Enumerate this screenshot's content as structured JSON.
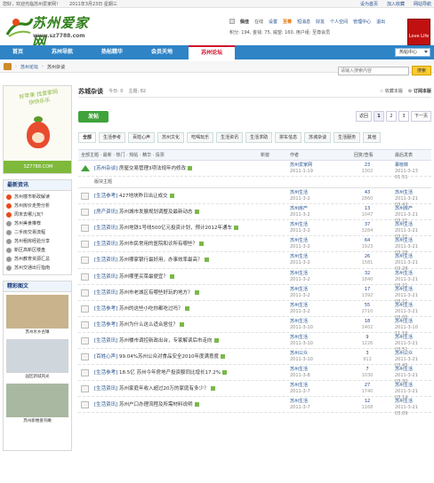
{
  "topbar": {
    "left": [
      "您好，欢迎光临苏州爱家网！",
      "2011年3月23日 星期三"
    ],
    "right": [
      "设为首页",
      "加入收藏",
      "网站导航"
    ]
  },
  "brand": {
    "name": "苏州爱家网",
    "url": "www.sz7788.com"
  },
  "user": {
    "name": "佩佳",
    "status": "在线",
    "settings": "设置",
    "vip": "至尊",
    "messages": "短消息",
    "friends": "好友",
    "spaces": "个人空间",
    "mgmt": "管理中心",
    "logout": "退出",
    "credits": "积分: 194, 金钱: 75, 威望: 160, 用户组: 至尊会员"
  },
  "promo": "Love Life",
  "nav": {
    "tabs": [
      "首页",
      "苏州导航",
      "热帖精华",
      "会员天地",
      "苏州论坛"
    ],
    "current": 4,
    "search": "热帖中心"
  },
  "breadcrumb": [
    "苏州论坛",
    "苏州杂谈"
  ],
  "sidebar": {
    "ad": {
      "text": "好苹果 找爱家网 快快乐乐",
      "site": "SZ7788.COM"
    },
    "hot_title": "最新资讯",
    "hot_items": [
      "苏州楼市新政解读",
      "苏州房价走势分析",
      "周末去哪儿玩？",
      "苏州美食推荐",
      "二手房交易流程",
      "苏州租房经验分享",
      "新区高新区楼盘",
      "苏州教育资源汇总",
      "苏州交通出行指南"
    ],
    "photo_title": "精彩图文",
    "photos": [
      "苏州水乡古镇",
      "园区新城风光",
      "苏州新楼盘鸟瞰"
    ]
  },
  "forum": {
    "title": "苏城杂谈",
    "today": "今日: 0",
    "topics": "主题: 82",
    "search_placeholder": "请输入搜索内容",
    "search_btn": "搜索",
    "rss": "收藏本版",
    "follow": "订阅本版",
    "post_btn": "发帖",
    "pager": [
      "返回",
      "1",
      "2",
      "3",
      "下一页"
    ]
  },
  "filters": [
    "全部",
    "生活参考",
    "百姓心声",
    "苏州文化",
    "吃喝玩乐",
    "生活资讯",
    "生活求助",
    "拼车信息",
    "苏城杂谈",
    "生活服务",
    "其他"
  ],
  "table_head": {
    "subject": "作者",
    "filters": "全部主题 · 最新 · 热门 · 热帖 · 精华 · 投票",
    "new": "新窗",
    "author": "作者",
    "replies": "回复/查看",
    "last": "最后发表"
  },
  "rows": [
    {
      "cat": "[苏州杂谈]",
      "title": "房屋交易管理3项法规年内修改",
      "hot": false,
      "top": true,
      "author": "苏州爱家网",
      "date": "2011-1-19",
      "r": "23",
      "v": "1302",
      "last_user": "慕晓菲",
      "last_date": "2011-3-23 01:51"
    },
    {
      "cat": "[生活参考]",
      "title": "427地块昨日出让成交",
      "hot": false,
      "top": false,
      "author": "苏州生活",
      "date": "2011-3-2",
      "r": "43",
      "v": "2860",
      "last_user": "苏州生活",
      "last_date": "2011-3-21 03:43"
    },
    {
      "cat": "[房产资讯]",
      "title": "苏州城市发展规划调整及最新动态",
      "hot": false,
      "top": false,
      "author": "苏州房产",
      "date": "2011-3-2",
      "r": "13",
      "v": "1047",
      "last_user": "苏州房产",
      "last_date": "2011-3-21 03:21"
    },
    {
      "cat": "[生活资讯]",
      "title": "苏州地铁1号线500亿元投资计划，预计2012年通车",
      "hot": false,
      "top": false,
      "author": "苏州生活",
      "date": "2011-3-2",
      "r": "37",
      "v": "3284",
      "last_user": "苏州生活",
      "last_date": "2011-3-21 03:21"
    },
    {
      "cat": "[生活资讯]",
      "title": "苏州市民常用的医院和诊所有哪些？",
      "hot": false,
      "top": false,
      "author": "苏州生活",
      "date": "2011-3-2",
      "r": "64",
      "v": "1923",
      "last_user": "苏州生活",
      "last_date": "2011-3-21 03:28"
    },
    {
      "cat": "[生活资讯]",
      "title": "苏州哪家银行最好用，办事效率最高？",
      "hot": false,
      "top": false,
      "author": "苏州生活",
      "date": "2011-3-2",
      "r": "26",
      "v": "1581",
      "last_user": "苏州生活",
      "last_date": "2011-3-21 03:28"
    },
    {
      "cat": "[生活资讯]",
      "title": "苏州哪里买菜最便宜？",
      "hot": false,
      "top": false,
      "author": "苏州生活",
      "date": "2011-3-2",
      "r": "32",
      "v": "1840",
      "last_user": "苏州生活",
      "last_date": "2011-3-21 03:21"
    },
    {
      "cat": "[生活资讯]",
      "title": "苏州市老城区有哪些好玩的地方？",
      "hot": false,
      "top": false,
      "author": "苏州生活",
      "date": "2011-3-2",
      "r": "17",
      "v": "1392",
      "last_user": "苏州生活",
      "last_date": "2011-3-21 03:21"
    },
    {
      "cat": "[生活参考]",
      "title": "苏州的这些小吃你都吃过吗？",
      "hot": false,
      "top": false,
      "author": "苏州生活",
      "date": "2011-3-2",
      "r": "55",
      "v": "2710",
      "last_user": "苏州生活",
      "last_date": "2011-3-21 03:05"
    },
    {
      "cat": "[生活参考]",
      "title": "苏州为什么这么适合居住？",
      "hot": false,
      "top": false,
      "author": "苏州生活",
      "date": "2011-3-10",
      "r": "18",
      "v": "1402",
      "last_user": "苏州生活",
      "last_date": "2011-3-10 11:16"
    },
    {
      "cat": "[生活资讯]",
      "title": "苏州楼市调控新政出台，专家解读后市走向",
      "hot": false,
      "top": false,
      "author": "苏州生活",
      "date": "2011-3-10",
      "r": "9",
      "v": "1226",
      "last_user": "苏州生活",
      "last_date": "2011-3-21 03:51"
    },
    {
      "cat": "[百姓心声]",
      "title": "99.04%苏州公众对食品安全2010年度满意度",
      "hot": false,
      "top": false,
      "author": "苏州公众",
      "date": "2011-3-10",
      "r": "3",
      "v": "912",
      "last_user": "苏州公众",
      "last_date": "2011-3-21 03:45"
    },
    {
      "cat": "[生活参考]",
      "title": "18.5亿 苏州今年房地产投资额同比增长17.2%",
      "hot": false,
      "top": false,
      "author": "苏州生活",
      "date": "2011-3-8",
      "r": "7",
      "v": "1030",
      "last_user": "苏州生活",
      "last_date": "2011-3-21 03:30"
    },
    {
      "cat": "[生活资讯]",
      "title": "苏州家庭年收入超过20万的家庭有多少？",
      "hot": false,
      "top": false,
      "author": "苏州生活",
      "date": "2011-3-7",
      "r": "27",
      "v": "1740",
      "last_user": "苏州生活",
      "last_date": "2011-3-21 03:14"
    },
    {
      "cat": "[生活资讯]",
      "title": "苏州户口办理流程及所需材料说明",
      "hot": false,
      "top": false,
      "author": "苏州生活",
      "date": "2011-3-7",
      "r": "12",
      "v": "1168",
      "last_user": "苏州生活",
      "last_date": "2011-3-21 03:09"
    }
  ],
  "divider": "版块主题",
  "colors": {
    "nav": "#2f84c6",
    "accent": "#d0102a",
    "post_button": "#3fa23a",
    "link": "#1f4e8c"
  }
}
